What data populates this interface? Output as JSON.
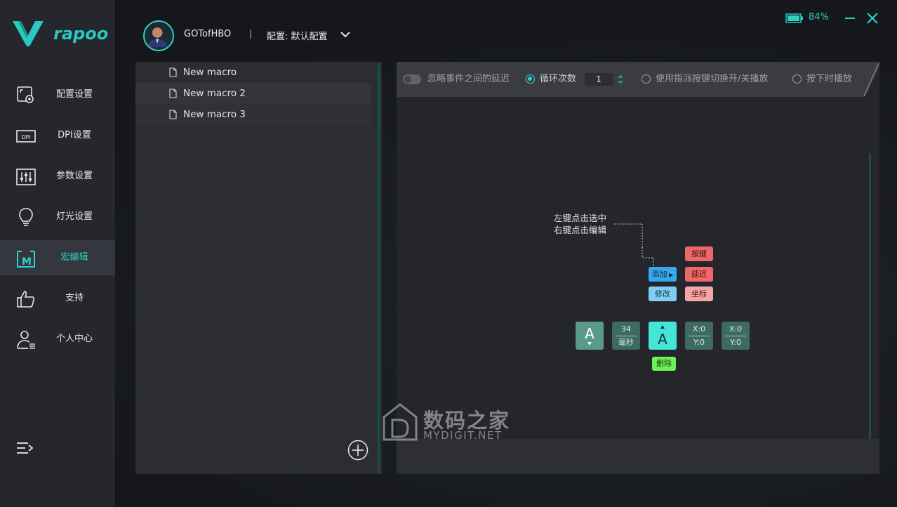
{
  "brand": {
    "logo_text": "rapoo",
    "accent": "#2ed3c8"
  },
  "header": {
    "username": "GOTofHBO",
    "separator": "|",
    "profile_label": "配置: 默认配置"
  },
  "window": {
    "battery_pct": "84%"
  },
  "sidebar": {
    "items": [
      {
        "label": "配置设置",
        "icon": "profile-settings-icon"
      },
      {
        "label": "DPI设置",
        "icon": "dpi-icon"
      },
      {
        "label": "参数设置",
        "icon": "sliders-icon"
      },
      {
        "label": "灯光设置",
        "icon": "lightbulb-icon"
      },
      {
        "label": "宏编辑",
        "icon": "macro-icon",
        "active": true
      },
      {
        "label": "支持",
        "icon": "thumbs-up-icon"
      },
      {
        "label": "个人中心",
        "icon": "user-icon"
      }
    ]
  },
  "macros": {
    "items": [
      "New macro",
      "New macro 2",
      "New macro 3"
    ]
  },
  "toolbar": {
    "ignore_delay_label": "忽略事件之间的延迟",
    "loop_label": "循环次数",
    "loop_count": "1",
    "toggle_by_key_label": "使用指派按键切换开/关播放",
    "play_while_held_label": "按下时播放"
  },
  "editor": {
    "hint_line1": "左键点击选中",
    "hint_line2": "右键点击编辑",
    "add_label": "添加",
    "modify_label": "修改",
    "key_label": "按键",
    "delay_label": "延迟",
    "coord_label": "坐标",
    "delete_label": "删除",
    "blocks": {
      "key1": "A",
      "delay_value": "34",
      "delay_unit": "毫秒",
      "key2": "A",
      "xy1_x": "X:0",
      "xy1_y": "Y:0",
      "xy2_x": "X:0",
      "xy2_y": "Y:0"
    }
  },
  "watermark": {
    "cn": "数码之家",
    "en": "MYDIGIT.NET"
  }
}
